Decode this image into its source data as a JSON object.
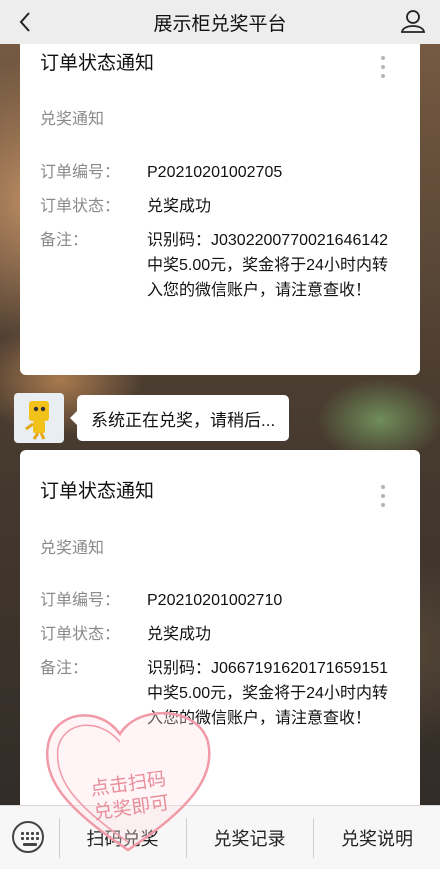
{
  "header": {
    "title": "展示柜兑奖平台"
  },
  "cards": [
    {
      "title": "订单状态通知",
      "subtitle": "兑奖通知",
      "order_label": "订单编号：",
      "order_value": "P20210201002705",
      "status_label": "订单状态：",
      "status_value": "兑奖成功",
      "note_label": "备注：",
      "note_value": "识别码：J030220077002164614​2中奖5.00元，奖金将于24小时内转入您的微信账户，请注意查收！"
    },
    {
      "title": "订单状态通知",
      "subtitle": "兑奖通知",
      "order_label": "订单编号：",
      "order_value": "P20210201002710",
      "status_label": "订单状态：",
      "status_value": "兑奖成功",
      "note_label": "备注：",
      "note_value": "识别码：J066719162017165915​1中奖5.00元，奖金将于24小时内转入您的微信账户，请注意查收！"
    }
  ],
  "chat": {
    "message": "系统正在兑奖，请稍后..."
  },
  "bottom_menu": {
    "items": [
      "扫码兑奖",
      "兑奖记录",
      "兑奖说明"
    ]
  },
  "sticker": {
    "line1": "点击扫码",
    "line2": "兑奖即可"
  }
}
